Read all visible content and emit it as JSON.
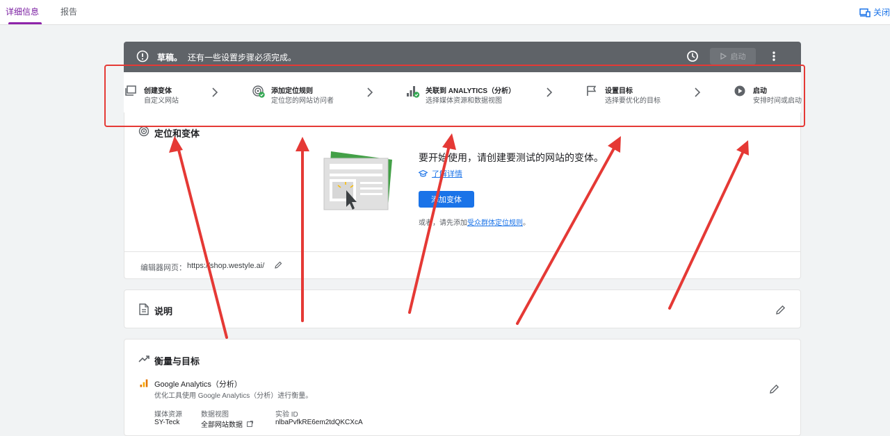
{
  "tabs": [
    {
      "label": "详细信息",
      "active": true
    },
    {
      "label": "报告",
      "active": false
    }
  ],
  "top_right": {
    "label": "关闭",
    "icon": "devices-icon"
  },
  "banner": {
    "status": "草稿。",
    "message": "还有一些设置步骤必须完成。",
    "launch_label": "启动",
    "background": "#5f6368"
  },
  "steps": [
    {
      "title": "创建变体",
      "subtitle": "自定义网站",
      "icon": "variants-icon"
    },
    {
      "title": "添加定位规则",
      "subtitle": "定位您的网站访问者",
      "icon": "target-check-icon"
    },
    {
      "title": "关联到 ANALYTICS（分析）",
      "subtitle": "选择媒体资源和数据视图",
      "icon": "analytics-check-icon"
    },
    {
      "title": "设置目标",
      "subtitle": "选择要优化的目标",
      "icon": "flag-icon"
    },
    {
      "title": "启动",
      "subtitle": "安排时间或启动",
      "icon": "play-circle-icon"
    }
  ],
  "targeting_card": {
    "title": "定位和变体",
    "message": "要开始使用，请创建要测试的网站的变体。",
    "learn_more": "了解详情",
    "add_variant_label": "添加变体",
    "or_prefix": "或者，请先添加",
    "or_link": "受众群体定位规则",
    "or_suffix": "。",
    "editor_label": "编辑器网页：",
    "editor_url": "https://shop.westyle.ai/"
  },
  "description_card": {
    "title": "说明"
  },
  "measurement_card": {
    "title": "衡量与目标",
    "ga_title": "Google Analytics（分析）",
    "ga_desc": "优化工具使用 Google Analytics（分析）进行衡量。",
    "fields": [
      {
        "label": "媒体资源",
        "value": "SY-Teck"
      },
      {
        "label": "数据视图",
        "value": "全部网站数据"
      },
      {
        "label": "实验 ID",
        "value": "nlbaPvfkRE6em2tdQKCXcA"
      }
    ]
  },
  "colors": {
    "accent": "#1a73e8",
    "tab_active": "#8e24aa",
    "annotation": "#e53935"
  }
}
